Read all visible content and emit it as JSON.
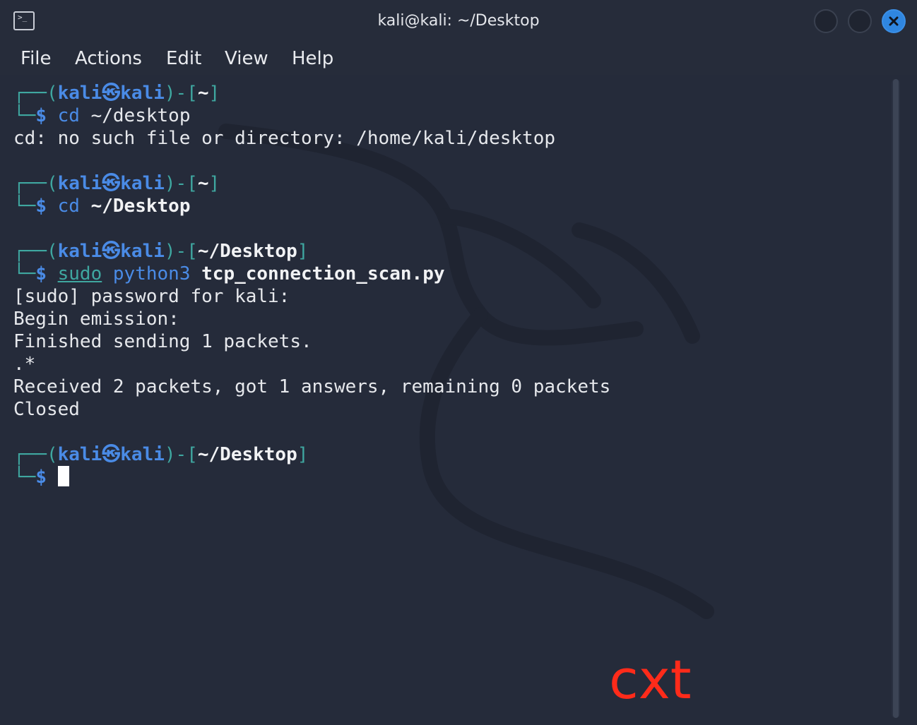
{
  "window": {
    "title": "kali@kali: ~/Desktop",
    "icon": "terminal-icon",
    "accent_close_color": "#2f86e0"
  },
  "menu": [
    "File",
    "Actions",
    "Edit",
    "View",
    "Help"
  ],
  "terminal": {
    "prompt_user": "kali",
    "prompt_symbol": "㉿",
    "prompt_host": "kali",
    "blocks": [
      {
        "cwd": "~",
        "cmd_name": "cd",
        "cmd_arg": "~/desktop",
        "output": [
          "cd: no such file or directory: /home/kali/desktop"
        ]
      },
      {
        "cwd": "~",
        "cmd_name": "cd",
        "cmd_arg": "~/Desktop",
        "output": []
      },
      {
        "cwd": "~/Desktop",
        "cmd_name": "sudo",
        "cmd_mid": "python3",
        "cmd_arg": "tcp_connection_scan.py",
        "output": [
          "[sudo] password for kali:",
          "Begin emission:",
          "Finished sending 1 packets.",
          ".*",
          "Received 2 packets, got 1 answers, remaining 0 packets",
          "Closed"
        ]
      },
      {
        "cwd": "~/Desktop",
        "cmd_name": "",
        "cmd_arg": "",
        "output": []
      }
    ],
    "dollar": "$"
  },
  "watermark": "cxt"
}
